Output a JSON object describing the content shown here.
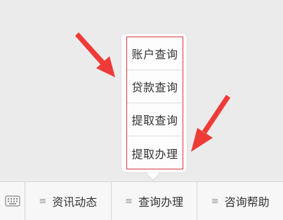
{
  "popup_menu": {
    "items": [
      {
        "label": "账户查询"
      },
      {
        "label": "贷款查询"
      },
      {
        "label": "提取查询"
      },
      {
        "label": "提取办理"
      }
    ]
  },
  "bottom_bar": {
    "keyboard_icon": "keyboard-icon",
    "tabs": [
      {
        "label": "资讯动态",
        "icon": "menu-lines-icon"
      },
      {
        "label": "查询办理",
        "icon": "menu-lines-icon"
      },
      {
        "label": "咨询帮助",
        "icon": "menu-lines-icon"
      }
    ]
  },
  "annotation_colors": {
    "arrow": "#ef3b36",
    "highlight_frame": "#d9363e"
  }
}
